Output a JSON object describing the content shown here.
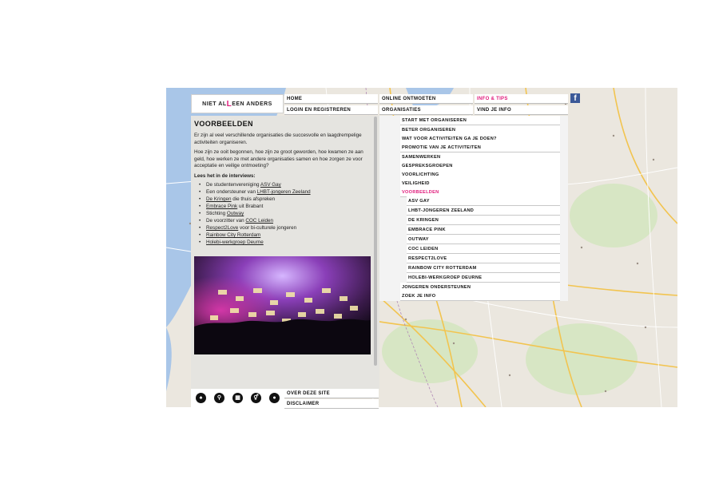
{
  "logo": {
    "text_before": "NIET AL",
    "text_q": "L",
    "text_after": "EEN ANDERS"
  },
  "nav": {
    "home": "HOME",
    "login": "LOGIN EN REGISTREREN",
    "online": "ONLINE ONTMOETEN",
    "organisaties": "ORGANISATIES",
    "info": "INFO & TIPS",
    "vind": "VIND JE INFO",
    "facebook": "f"
  },
  "content": {
    "title": "VOORBEELDEN",
    "para1": "Er zijn al veel verschillende organisaties die succesvolle en laagdrempelige activiteiten organiseren.",
    "para2": "Hoe zijn ze ooit begonnen, hoe zijn ze groot geworden, hoe kwamen ze aan geld, hoe werken ze met andere organisaties samen en hoe zorgen ze voor acceptatie en veilige ontmoeting?",
    "lees": "Lees het in de interviews:",
    "interviews": [
      {
        "pre": "De studentenvereniging ",
        "link": "ASV Gay",
        "post": ""
      },
      {
        "pre": "Een ondersteuner van ",
        "link": "LHBT-jongeren Zeeland",
        "post": ""
      },
      {
        "pre": "",
        "link": "De Kringen",
        "post": " die thuis afspreken"
      },
      {
        "pre": "",
        "link": "Embrace Pink",
        "post": " uit Brabant"
      },
      {
        "pre": "Stichting ",
        "link": "Outway",
        "post": ""
      },
      {
        "pre": "De voorzitter van ",
        "link": "COC Leiden",
        "post": ""
      },
      {
        "pre": "",
        "link": "Respect2Love",
        "post": " voor bi-culturele jongeren"
      },
      {
        "pre": "",
        "link": "Rainbow City Rotterdam",
        "post": ""
      },
      {
        "pre": "",
        "link": "Holebi-werkgroep Deurne",
        "post": ""
      }
    ]
  },
  "dropdown": [
    {
      "label": "START MET ORGANISEREN",
      "level": 0
    },
    {
      "label": "BETER ORGANISEREN",
      "level": 0
    },
    {
      "label": "WAT VOOR ACTIVITEITEN GA JE DOEN?",
      "level": 0
    },
    {
      "label": "PROMOTIE VAN JE ACTIVITEITEN",
      "level": 0
    },
    {
      "label": "SAMENWERKEN",
      "level": 0
    },
    {
      "label": "GESPREKSGROEPEN",
      "level": 0
    },
    {
      "label": "VOORLICHTING",
      "level": 0
    },
    {
      "label": "VEILIGHEID",
      "level": 0
    },
    {
      "label": "VOORBEELDEN",
      "level": 0,
      "active": true
    },
    {
      "label": "ASV GAY",
      "level": 1
    },
    {
      "label": "LHBT-JONGEREN ZEELAND",
      "level": 1
    },
    {
      "label": "DE KRINGEN",
      "level": 1
    },
    {
      "label": "EMBRACE PINK",
      "level": 1
    },
    {
      "label": "OUTWAY",
      "level": 1
    },
    {
      "label": "COC LEIDEN",
      "level": 1
    },
    {
      "label": "RESPECT2LOVE",
      "level": 1
    },
    {
      "label": "RAINBOW CITY ROTTERDAM",
      "level": 1
    },
    {
      "label": "HOLEBI-WERKGROEP DEURNE",
      "level": 1
    },
    {
      "label": "JONGEREN ONDERSTEUNEN",
      "level": 0
    },
    {
      "label": "ZOEK JE INFO",
      "level": 0
    }
  ],
  "footer": {
    "over": "OVER DEZE SITE",
    "disclaimer": "DISCLAIMER"
  },
  "icons": [
    "person-icon",
    "search-icon",
    "calendar-icon",
    "gender-icon",
    "location-pin-icon"
  ],
  "colors": {
    "accent": "#e0197a",
    "facebook": "#3b5998",
    "panel": "#e5e4e0"
  }
}
